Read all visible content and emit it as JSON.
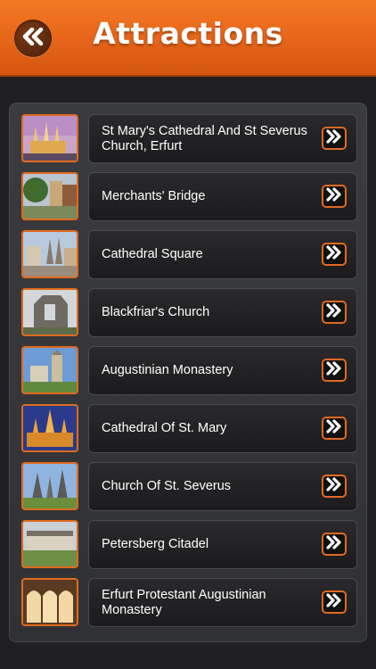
{
  "header": {
    "title": "Attractions",
    "back_icon": "double-chevron-left-icon"
  },
  "colors": {
    "header": "#e6641a",
    "accent": "#e06a1e",
    "background": "#1f1f21"
  },
  "attractions": [
    {
      "label": "St Mary's Cathedral And St Severus Church, Erfurt",
      "thumb": "cathedral-illuminated"
    },
    {
      "label": "Merchants' Bridge",
      "thumb": "bridge-houses"
    },
    {
      "label": "Cathedral Square",
      "thumb": "square-spires"
    },
    {
      "label": "Blackfriar's Church",
      "thumb": "ruined-church"
    },
    {
      "label": "Augustinian Monastery",
      "thumb": "monastery-tower"
    },
    {
      "label": "Cathedral Of St. Mary",
      "thumb": "cathedral-night"
    },
    {
      "label": "Church Of St. Severus",
      "thumb": "church-towers"
    },
    {
      "label": "Petersberg Citadel",
      "thumb": "citadel"
    },
    {
      "label": "Erfurt Protestant Augustinian Monastery",
      "thumb": "cloister"
    }
  ]
}
